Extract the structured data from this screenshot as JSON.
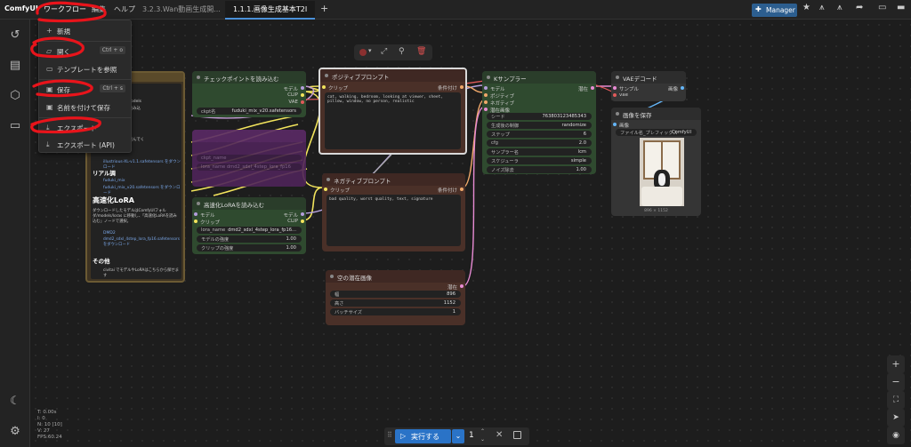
{
  "topbar": {
    "logo": "ComfyUI",
    "workflow_menu": "ワークフロー",
    "edit_menu": "編集",
    "help_menu": "ヘルプ",
    "tabs": [
      "3.2.3.Wan動画生成開...",
      "1.1.1.画像生成基本T2I"
    ],
    "add_tab": "+",
    "manager_label": "Manager"
  },
  "workflow_menu_items": [
    {
      "icon": "plus-icon",
      "label": "新規",
      "shortcut": ""
    },
    {
      "icon": "folder-open-icon",
      "label": "開く",
      "shortcut": "Ctrl + o"
    },
    {
      "icon": "folder-icon",
      "label": "テンプレートを参照",
      "shortcut": ""
    },
    {
      "icon": "save-icon",
      "label": "保存",
      "shortcut": "Ctrl + s"
    },
    {
      "icon": "save-as-icon",
      "label": "名前を付けて保存",
      "shortcut": ""
    },
    {
      "icon": "export-icon",
      "label": "エクスポート",
      "shortcut": ""
    },
    {
      "icon": "export-api-icon",
      "label": "エクスポート (API)",
      "shortcut": ""
    }
  ],
  "notes_node": {
    "line1": "ComfyUIフォルダ/models",
    "line2": "チェックポイントを読み込",
    "line3": "ルの使用上の注意を読んでく",
    "heading_real": "リアル調",
    "links_real": [
      "fuduki_mix",
      "fuduki_mix_v20.safetensors をダウンロード"
    ],
    "link_first": "illustrious-XL-v1.1.safetensors をダウンロード",
    "heading_lora": "高速化LoRA",
    "lora_text": "ダウンロードしたモデルはComfyUIフォルダ/models/loras に移動し、「高速化LoRAを読み込む」ノードで選択。",
    "lora_links": [
      "DMD2",
      "dmd2_sdxl_4step_lora_fp16.safetensors をダウンロード"
    ],
    "heading_other": "その他",
    "other_text": "civitai でモデルやLoRAはこちらから探せます"
  },
  "checkpoint_node": {
    "title": "チェックポイントを読み込む",
    "outputs": [
      "モデル",
      "CLIP",
      "VAE"
    ],
    "widget_label": "ckpt名",
    "widget_value": "fuduki_mix_v20.safetensors"
  },
  "muted_node": {
    "rows": [
      "ckpt_name",
      "lora_name  dmd2_sdxl_4step_lora_fp16"
    ]
  },
  "lora_node": {
    "title": "高速化LoRAを読み込む",
    "inputs": [
      "モデル",
      "クリップ"
    ],
    "outputs": [
      "モデル",
      "CLIP"
    ],
    "widgets": [
      {
        "label": "lora_name",
        "value": "dmd2_sdxl_4step_lora_fp16..."
      },
      {
        "label": "モデルの強度",
        "value": "1.00"
      },
      {
        "label": "クリップの強度",
        "value": "1.00"
      }
    ]
  },
  "positive_node": {
    "title": "ポジティブプロンプト",
    "input": "クリップ",
    "output": "条件付け",
    "text": "cat, walking, bedroom, looking at viewer, sheet, pillow, window, no person, realistic"
  },
  "negative_node": {
    "title": "ネガティブプロンプト",
    "input": "クリップ",
    "output": "条件付け",
    "text": "bad quality, worst quality, text, signature"
  },
  "latent_node": {
    "title": "空の潜在画像",
    "output": "潜在",
    "widgets": [
      {
        "label": "幅",
        "value": "896"
      },
      {
        "label": "高さ",
        "value": "1152"
      },
      {
        "label": "バッチサイズ",
        "value": "1"
      }
    ]
  },
  "ksampler_node": {
    "title": "Kサンプラー",
    "inputs": [
      "モデル",
      "ポジティブ",
      "ネガティブ",
      "潜在画像"
    ],
    "output": "潜在",
    "widgets": [
      {
        "label": "シード",
        "value": "763803123485343"
      },
      {
        "label": "生成後の制御",
        "value": "randomize"
      },
      {
        "label": "ステップ",
        "value": "6"
      },
      {
        "label": "cfg",
        "value": "2.0"
      },
      {
        "label": "サンプラー名",
        "value": "lcm"
      },
      {
        "label": "スケジューラ",
        "value": "simple"
      },
      {
        "label": "ノイズ除去",
        "value": "1.00"
      }
    ]
  },
  "vae_node": {
    "title": "VAEデコード",
    "inputs": [
      "サンプル",
      "vae"
    ],
    "output": "画像"
  },
  "save_node": {
    "title": "画像を保存",
    "input": "画像",
    "widget_label": "ファイル名_プレフィックス",
    "widget_value": "ComfyUI",
    "image_caption": "896 × 1152"
  },
  "stats": [
    "T: 0.00s",
    "I: 0",
    "N: 10 [10]",
    "V: 27",
    "FPS:60.24"
  ],
  "run_bar": {
    "run_label": "実行する",
    "count": "1"
  },
  "colors": {
    "annotation_red": "#e8141b",
    "node_green": "#2f4a2f",
    "node_brown": "#4a3028",
    "node_dark": "#353535",
    "run_blue": "#2a73c7",
    "link_pink": "#d88bd0",
    "link_yellow": "#f2e45c"
  }
}
